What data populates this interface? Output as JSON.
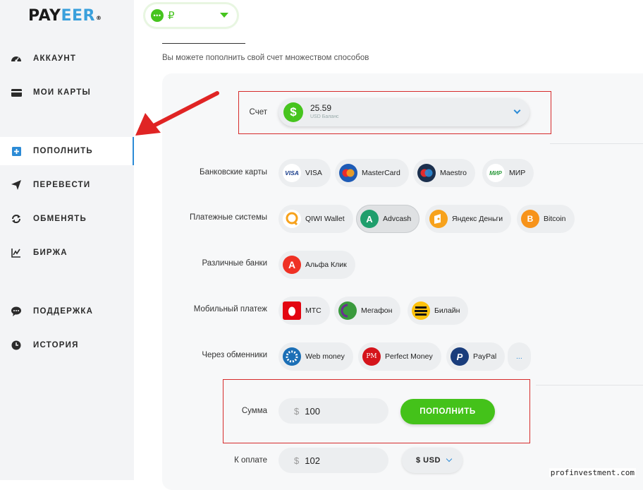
{
  "brand": {
    "logo_part1": "PAY",
    "logo_part2": "EER",
    "registered": "®"
  },
  "sidebar": {
    "items": [
      {
        "label": "АККАУНТ",
        "icon": "gauge-icon"
      },
      {
        "label": "МОИ КАРТЫ",
        "icon": "card-icon"
      },
      {
        "label": "ПОПОЛНИТЬ",
        "icon": "plus-square-icon",
        "active": true
      },
      {
        "label": "ПЕРЕВЕСТИ",
        "icon": "paper-plane-icon"
      },
      {
        "label": "ОБМЕНЯТЬ",
        "icon": "exchange-icon"
      },
      {
        "label": "БИРЖА",
        "icon": "chart-icon"
      },
      {
        "label": "ПОДДЕРЖКА",
        "icon": "chat-icon"
      },
      {
        "label": "ИСТОРИЯ",
        "icon": "clock-icon"
      }
    ]
  },
  "header": {
    "currency_symbol": "₽",
    "currency_dots": "•••"
  },
  "main": {
    "subtitle": "Вы можете пополнить свой счет множеством способов",
    "account": {
      "label": "Счет",
      "icon_symbol": "$",
      "amount": "25.59",
      "sub": "USD Баланс"
    },
    "groups": [
      {
        "label": "Банковские карты",
        "items": [
          "VISA",
          "MasterCard",
          "Maestro",
          "МИР"
        ]
      },
      {
        "label": "Платежные системы",
        "items": [
          "QIWI Wallet",
          "Advcash",
          "Яндекс Деньги",
          "Bitcoin"
        ],
        "selected": "Advcash"
      },
      {
        "label": "Различные банки",
        "items": [
          "Альфа Клик"
        ]
      },
      {
        "label": "Мобильный платеж",
        "items": [
          "МТС",
          "Мегафон",
          "Билайн"
        ]
      },
      {
        "label": "Через обменники",
        "items": [
          "Web money",
          "Perfect Money",
          "PayPal",
          "..."
        ]
      }
    ],
    "amount": {
      "label": "Сумма",
      "currency_sign": "$",
      "value": "100"
    },
    "submit_label": "ПОПОЛНИТЬ",
    "to_pay": {
      "label": "К оплате",
      "currency_sign": "$",
      "value": "102"
    },
    "currency_select": "$ USD"
  },
  "icon_text": {
    "visa": "VISA",
    "mir": "МИР",
    "pm": "PM",
    "paypal": "P",
    "bitcoin": "B",
    "alfa": "A",
    "advcash": "A"
  },
  "colors": {
    "accent_green": "#44c21a",
    "accent_blue": "#2c8bd6",
    "annotation_red": "#d62b2b"
  },
  "watermark": "profinvestment.com"
}
